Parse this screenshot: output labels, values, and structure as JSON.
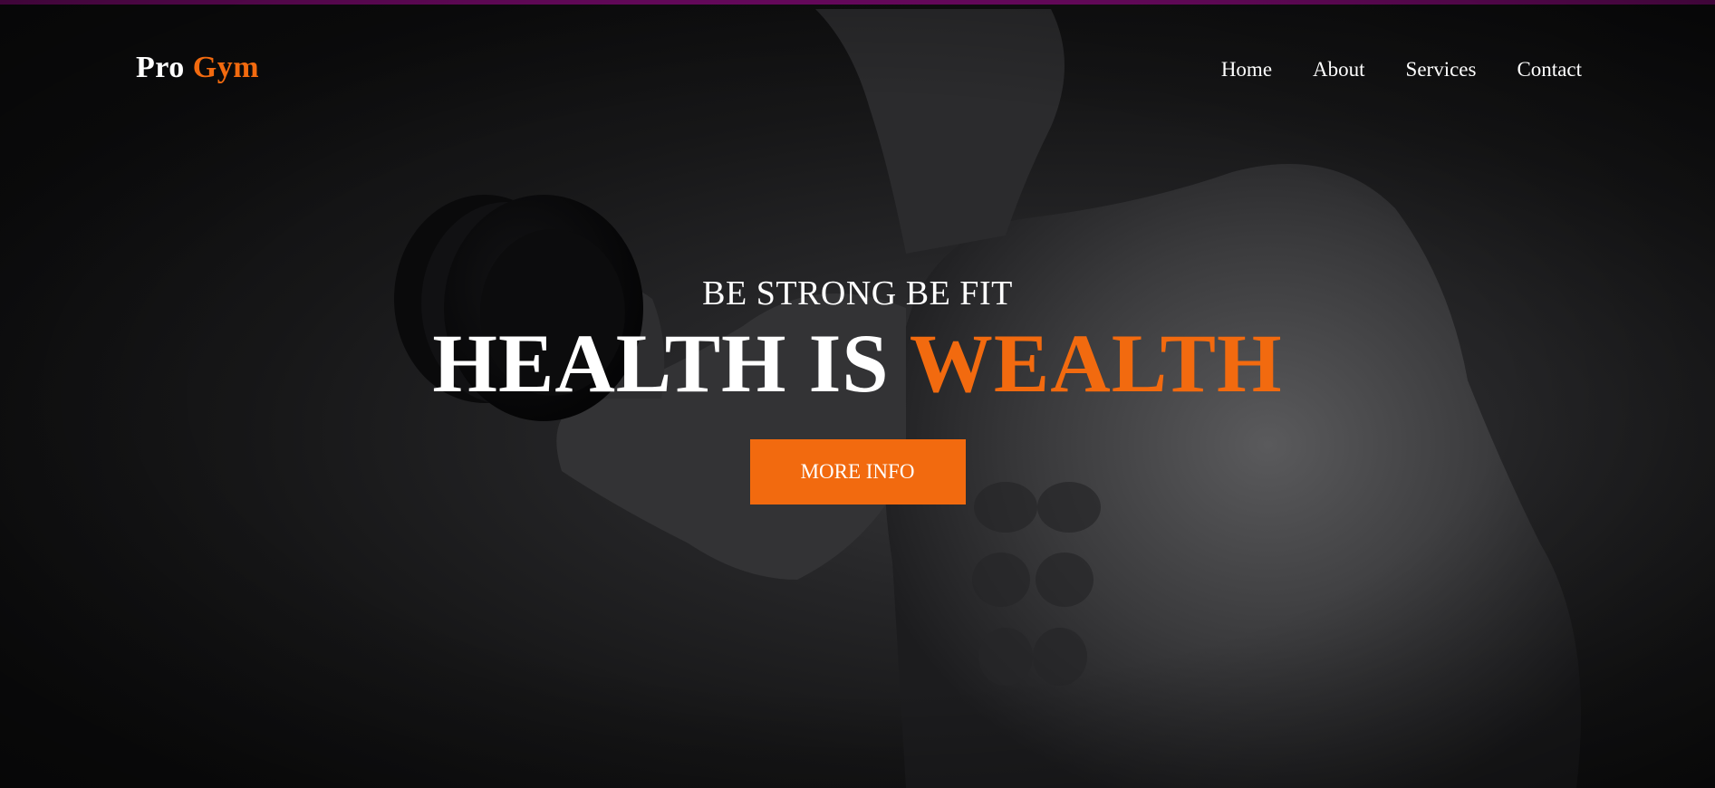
{
  "brand": {
    "name_first": "Pro",
    "name_accent": "Gym",
    "accent_color": "#f26a0f"
  },
  "nav": {
    "items": [
      {
        "label": "Home"
      },
      {
        "label": "About"
      },
      {
        "label": "Services"
      },
      {
        "label": "Contact"
      }
    ]
  },
  "hero": {
    "tagline": "BE STRONG BE FIT",
    "headline_plain": "HEALTH IS ",
    "headline_accent": "WEALTH",
    "cta_label": "MORE INFO",
    "background_image": "bodybuilder-with-dumbbell-photo"
  },
  "colors": {
    "top_strip": "#7a0a6e",
    "background": "#0f0f10",
    "text": "#ffffff",
    "accent": "#f26a0f"
  }
}
